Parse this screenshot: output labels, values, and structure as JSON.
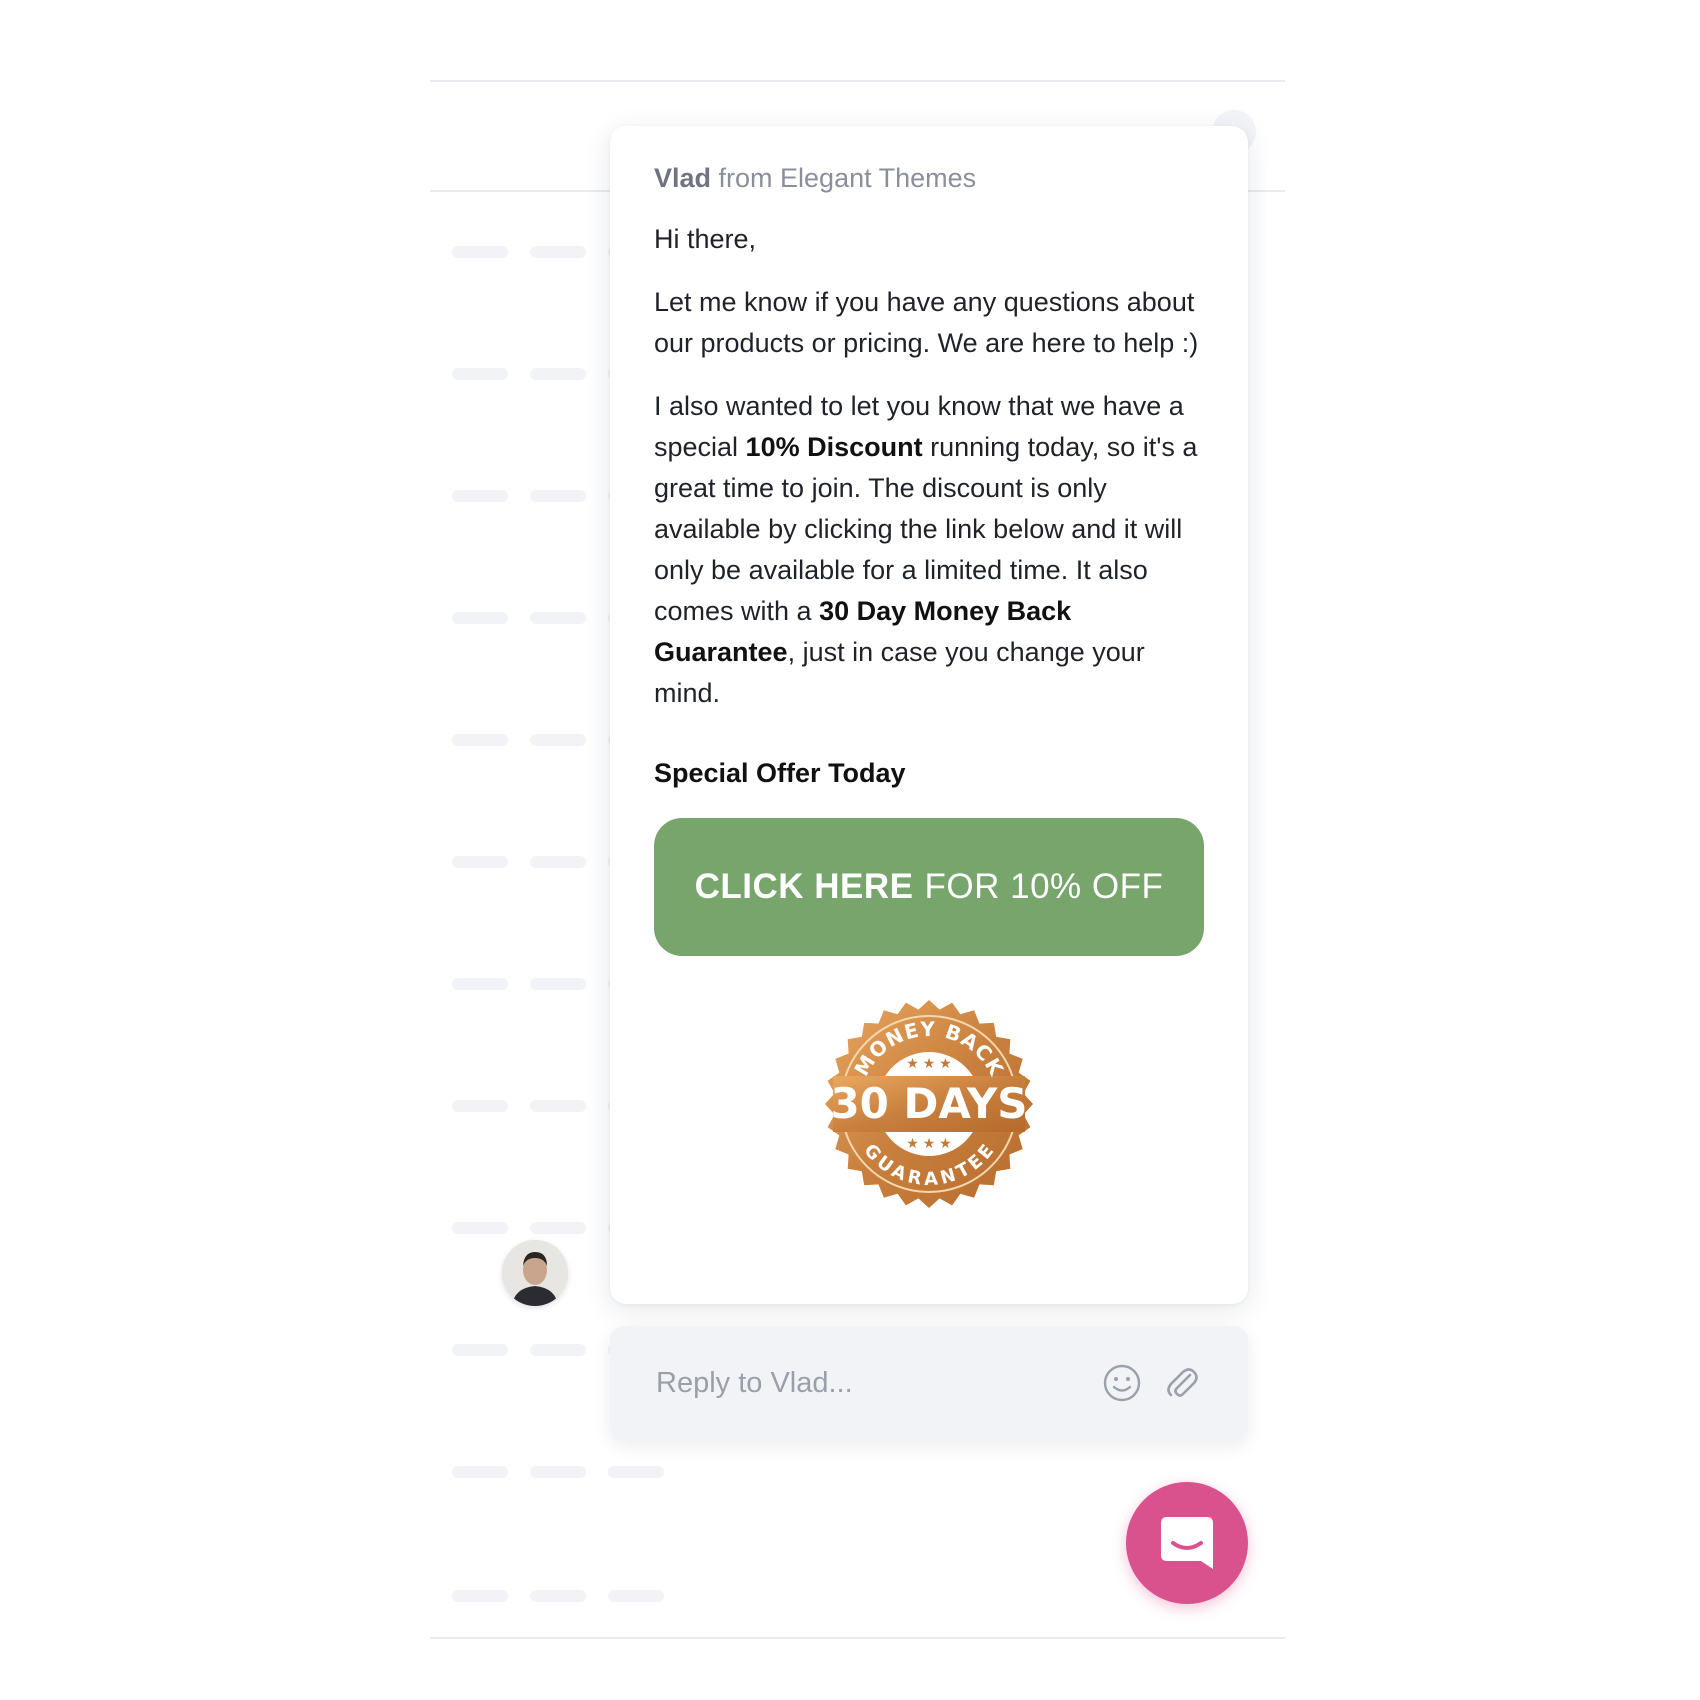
{
  "message": {
    "sender_name": "Vlad",
    "sender_suffix": " from Elegant Themes",
    "greeting": "Hi there,",
    "paragraph1": "Let me know if you have any questions about our products or pricing. We are here to help :)",
    "paragraph2": {
      "part1": "I also wanted to let you know that we have a special ",
      "bold1": "10% Discount",
      "part2": " running today, so it's a great time to join. The discount is only available by clicking the link below and it will only be available for a limited time. It also comes with a ",
      "bold2": "30 Day Money Back Guarantee",
      "part3": ", just in case you change your mind."
    },
    "offer_title": "Special Offer Today",
    "cta": {
      "strong": "CLICK HERE",
      "rest": "FOR 10% OFF",
      "color": "#78a56c"
    },
    "badge": {
      "top_text": "MONEY BACK",
      "main_text": "30 DAYS",
      "bottom_text": "GUARANTEE",
      "color": "#d08a45"
    }
  },
  "avatar": {
    "icon": "user-avatar"
  },
  "reply": {
    "placeholder": "Reply to Vlad...",
    "emoji_icon": "smiley-icon",
    "attach_icon": "paperclip-icon"
  },
  "launcher": {
    "icon": "chat-bubble-icon",
    "color": "#d9528d"
  }
}
